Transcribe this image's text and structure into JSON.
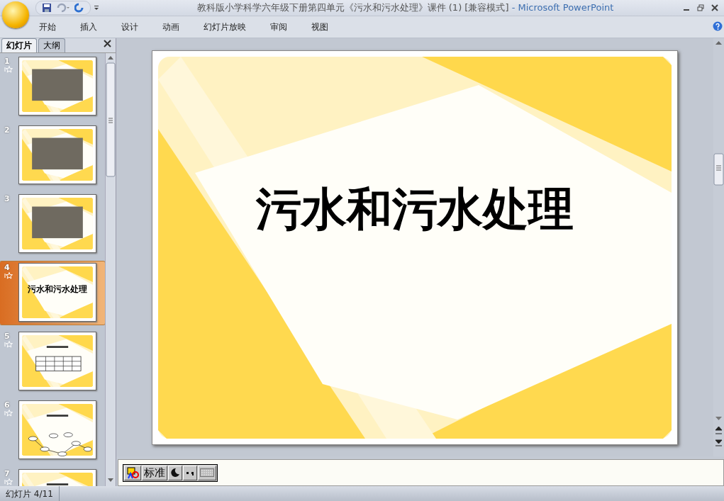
{
  "window": {
    "title": "教科版小学科学六年级下册第四单元《污水和污水处理》课件 (1) [兼容模式]",
    "separator": "-",
    "app_name": "Microsoft PowerPoint"
  },
  "ribbon_tabs": [
    {
      "label": "开始",
      "selected": false
    },
    {
      "label": "插入",
      "selected": false
    },
    {
      "label": "设计",
      "selected": false
    },
    {
      "label": "动画",
      "selected": false
    },
    {
      "label": "幻灯片放映",
      "selected": false
    },
    {
      "label": "审阅",
      "selected": false
    },
    {
      "label": "视图",
      "selected": false
    }
  ],
  "panel_tabs": [
    {
      "label": "幻灯片",
      "selected": true
    },
    {
      "label": "大纲",
      "selected": false
    }
  ],
  "slides": [
    {
      "number": "1",
      "kind": "photo",
      "animated": true,
      "selected": false
    },
    {
      "number": "2",
      "kind": "photo",
      "animated": false,
      "selected": false
    },
    {
      "number": "3",
      "kind": "photo",
      "animated": false,
      "selected": false
    },
    {
      "number": "4",
      "kind": "title",
      "title": "污水和污水处理",
      "animated": true,
      "selected": true
    },
    {
      "number": "5",
      "kind": "table",
      "animated": true,
      "selected": false
    },
    {
      "number": "6",
      "kind": "diagram",
      "animated": true,
      "selected": false
    },
    {
      "number": "7",
      "kind": "text",
      "animated": true,
      "selected": false
    }
  ],
  "slide": {
    "title": "污水和污水处理"
  },
  "ime_toolbar": {
    "mode": "标准"
  },
  "status_bar": {
    "slide_info": "幻灯片 4/11"
  }
}
